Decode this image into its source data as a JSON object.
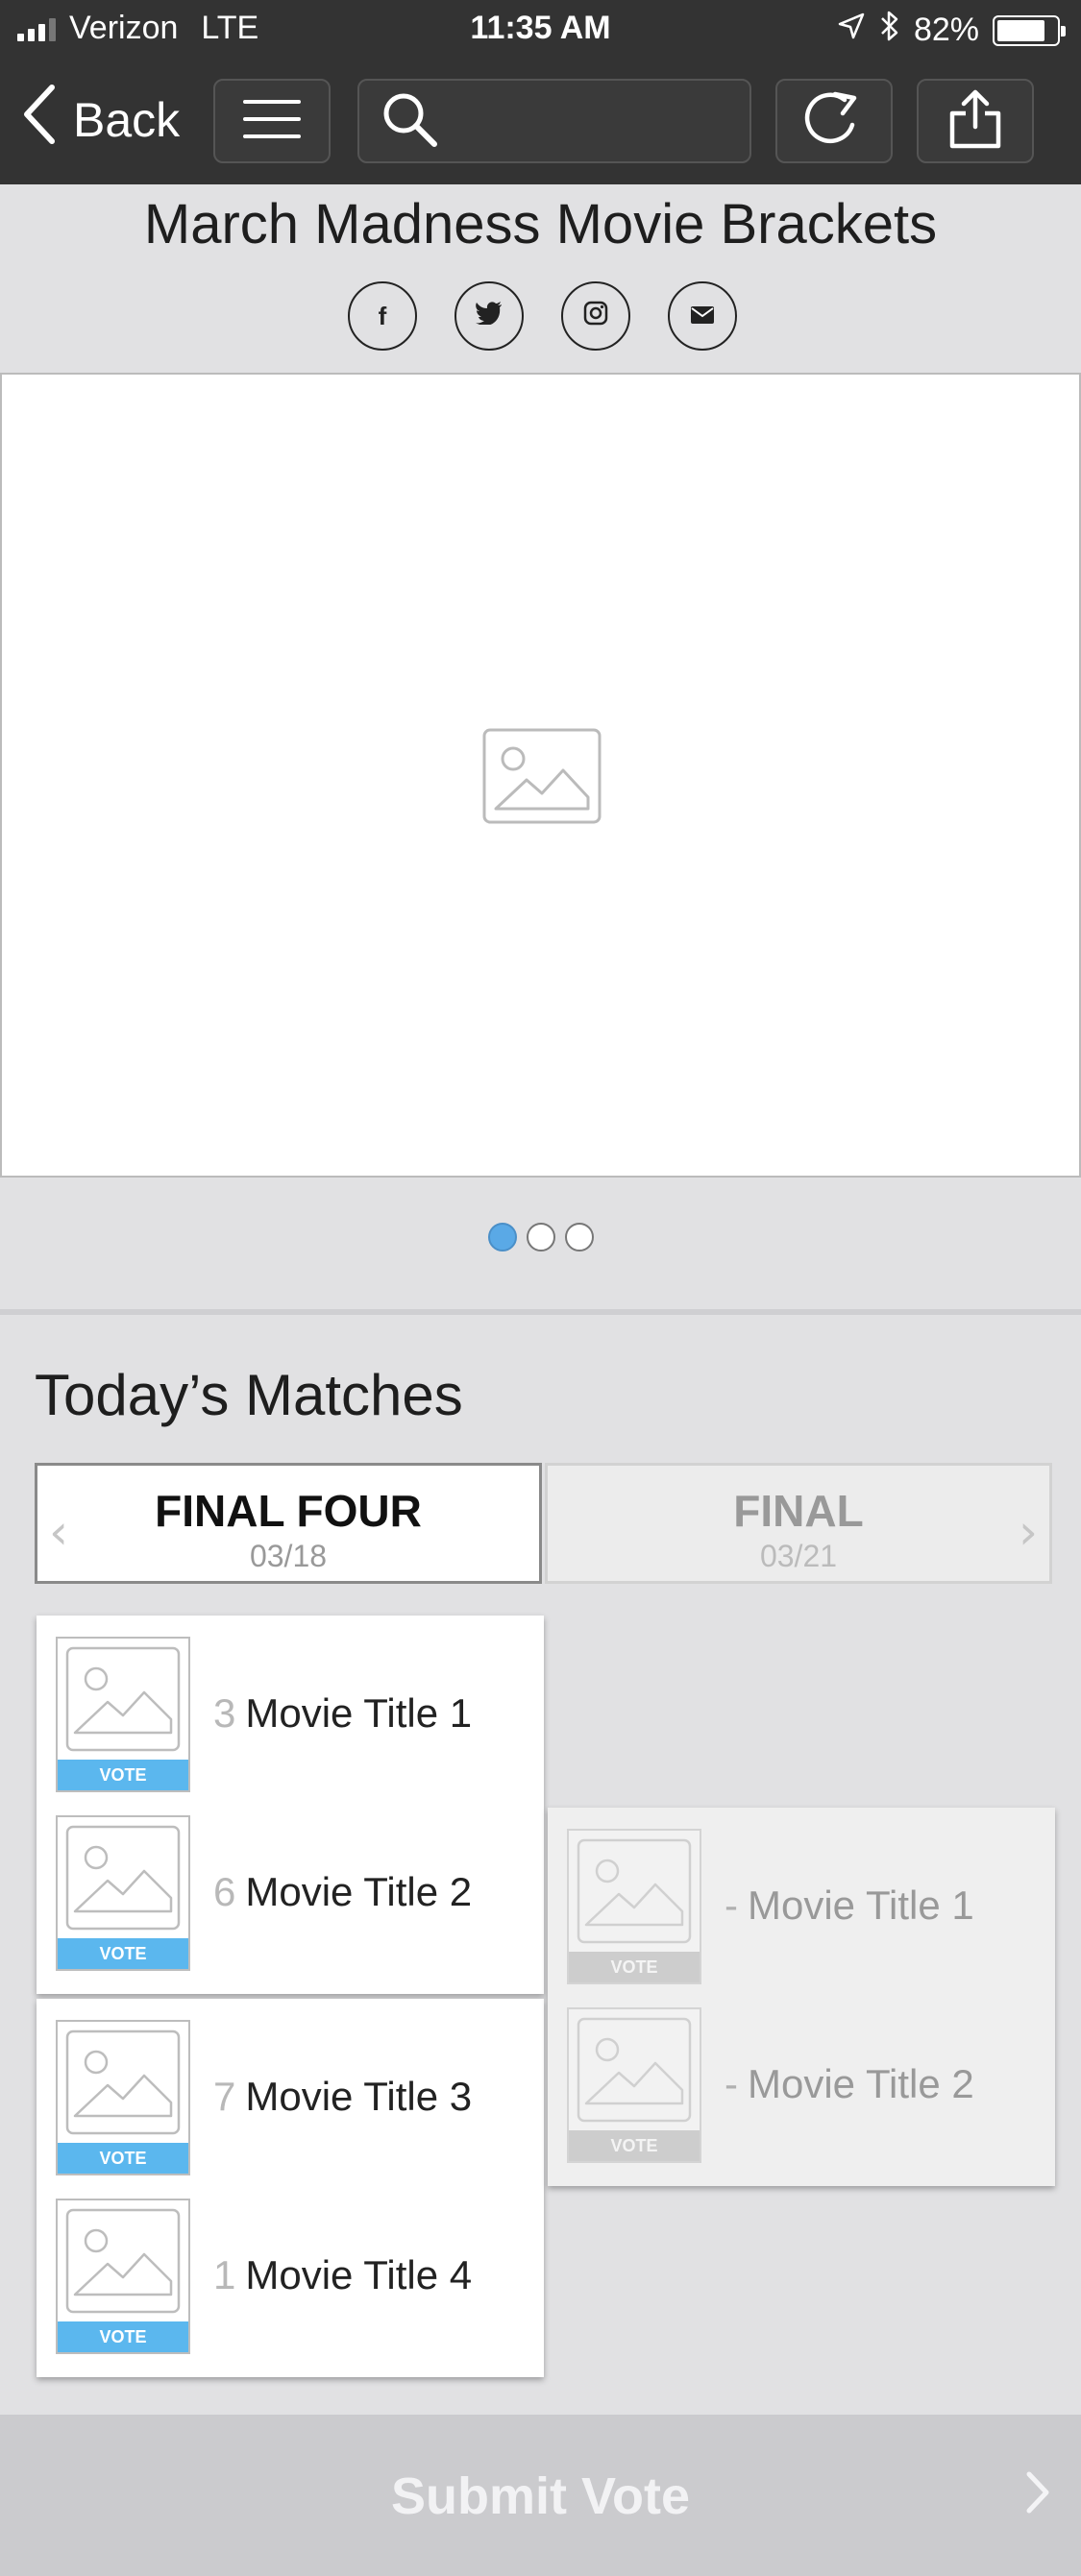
{
  "status_bar": {
    "carrier": "Verizon",
    "network": "LTE",
    "time": "11:35 AM",
    "battery": "82%",
    "battery_level": 0.82
  },
  "toolbar": {
    "back_label": "Back",
    "icons": [
      "chevron-left-icon",
      "hamburger-menu-icon",
      "search-icon",
      "refresh-icon",
      "share-icon"
    ]
  },
  "header": {
    "title": "March Madness Movie Brackets",
    "social": [
      {
        "glyph": "f",
        "icon": "facebook-icon"
      },
      {
        "glyph": "t",
        "icon": "twitter-icon"
      },
      {
        "glyph": "i",
        "icon": "instagram-icon"
      },
      {
        "glyph": "e",
        "icon": "email-icon"
      }
    ]
  },
  "carousel": {
    "page_count": 3,
    "active_index": 0
  },
  "matches": {
    "section_title": "Today’s Matches",
    "rounds": [
      {
        "name": "FINAL FOUR",
        "date": "03/18",
        "active": true
      },
      {
        "name": "FINAL",
        "date": "03/21",
        "active": false
      }
    ],
    "vote_label": "VOTE",
    "final_four": [
      {
        "seed": "3",
        "title": "Movie Title 1"
      },
      {
        "seed": "6",
        "title": "Movie Title 2"
      },
      {
        "seed": "7",
        "title": "Movie Title 3"
      },
      {
        "seed": "1",
        "title": "Movie Title 4"
      }
    ],
    "final": [
      {
        "seed": "-",
        "title": "Movie Title 1"
      },
      {
        "seed": "-",
        "title": "Movie Title 2"
      }
    ]
  },
  "footer": {
    "submit_label": "Submit Vote"
  },
  "colors": {
    "accent_blue": "#5bb7ee",
    "toolbar_bg": "#333333",
    "page_bg": "#e1e1e3"
  }
}
